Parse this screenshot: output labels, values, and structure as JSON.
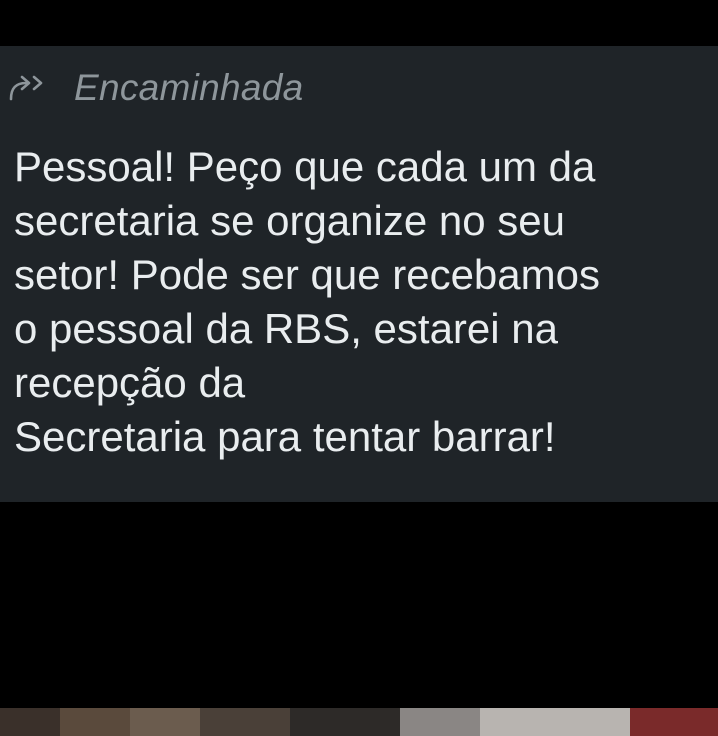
{
  "message": {
    "forwarded_icon": "forward-arrow-icon",
    "forwarded_label": "Encaminhada",
    "lines": [
      "Pessoal! Peço que cada um da",
      "secretaria se organize no seu",
      "setor! Pode ser que recebamos",
      "o pessoal da RBS, estarei na",
      "recepção da",
      "Secretaria para tentar barrar!"
    ]
  },
  "colors": {
    "background": "#000000",
    "bubble": "#1f2428",
    "text": "#e9edef",
    "forwarded_label": "#8e969b"
  }
}
